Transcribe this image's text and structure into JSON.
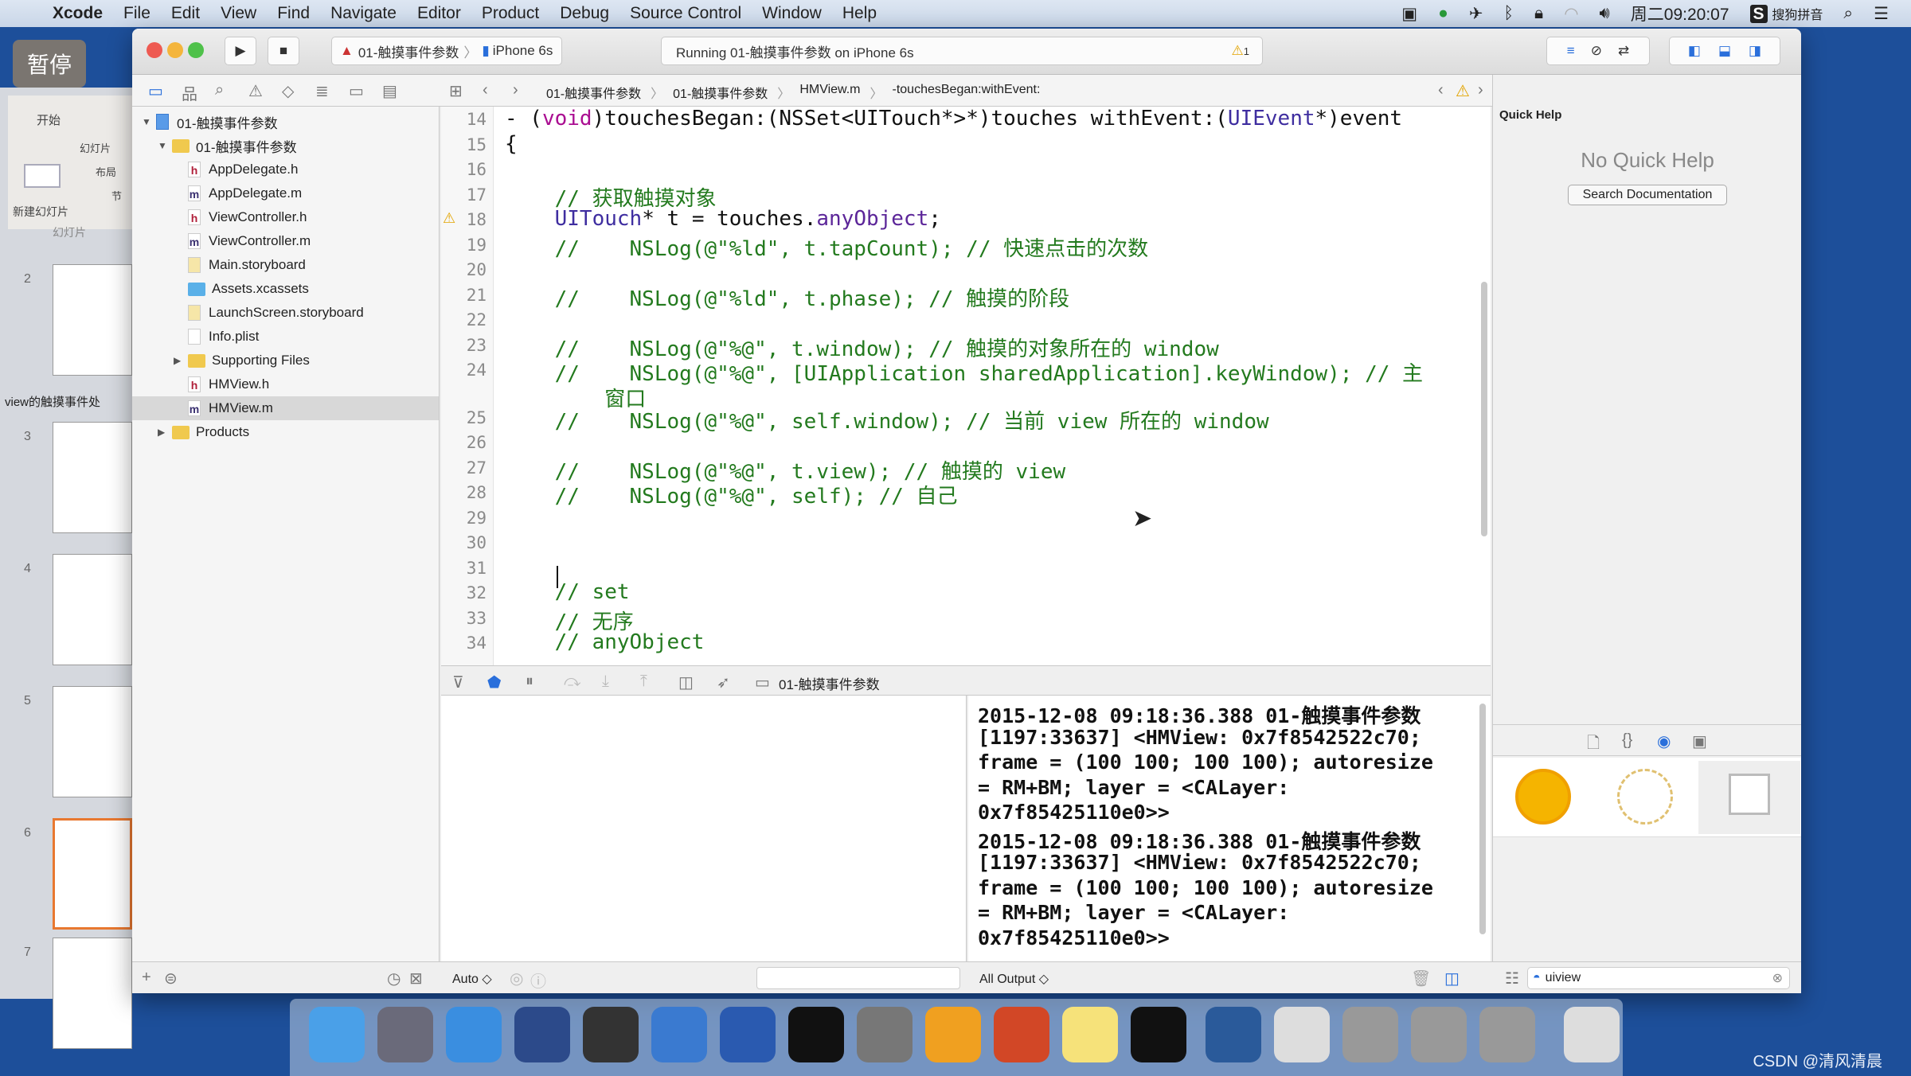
{
  "overlay": {
    "pause": "暂停"
  },
  "menubar": {
    "app": "Xcode",
    "items": [
      "File",
      "Edit",
      "View",
      "Find",
      "Navigate",
      "Editor",
      "Product",
      "Debug",
      "Source Control",
      "Window",
      "Help"
    ],
    "clock": "周二09:20:07",
    "ime": "搜狗拼音"
  },
  "ppt": {
    "tab_home": "开始",
    "group_slides": "幻灯片",
    "new_slide": "新建幻灯片",
    "layout": "布局",
    "section": "节",
    "tab_slides": "幻灯片",
    "section_label": "view的触摸事件处",
    "slide_numbers": [
      "2",
      "3",
      "4",
      "5",
      "6",
      "7"
    ]
  },
  "toolbar": {
    "scheme": "01-触摸事件参数",
    "device": "iPhone 6s",
    "status": "Running 01-触摸事件参数 on iPhone 6s",
    "warning_count": "1"
  },
  "jumpbar": {
    "crumbs": [
      "01-触摸事件参数",
      "01-触摸事件参数",
      "HMView.m",
      "-touchesBegan:withEvent:"
    ]
  },
  "navigator": {
    "items": [
      {
        "label": "01-触摸事件参数",
        "type": "project",
        "level": 0
      },
      {
        "label": "01-触摸事件参数",
        "type": "folder",
        "level": 1
      },
      {
        "label": "AppDelegate.h",
        "type": "h",
        "level": 2
      },
      {
        "label": "AppDelegate.m",
        "type": "m",
        "level": 2
      },
      {
        "label": "ViewController.h",
        "type": "h",
        "level": 2
      },
      {
        "label": "ViewController.m",
        "type": "m",
        "level": 2
      },
      {
        "label": "Main.storyboard",
        "type": "sb",
        "level": 2
      },
      {
        "label": "Assets.xcassets",
        "type": "assets",
        "level": 2
      },
      {
        "label": "LaunchScreen.storyboard",
        "type": "sb",
        "level": 2
      },
      {
        "label": "Info.plist",
        "type": "plist",
        "level": 2
      },
      {
        "label": "Supporting Files",
        "type": "folder-closed",
        "level": 2
      },
      {
        "label": "HMView.h",
        "type": "h",
        "level": 2
      },
      {
        "label": "HMView.m",
        "type": "m",
        "level": 2,
        "selected": true
      },
      {
        "label": "Products",
        "type": "folder-closed",
        "level": 1
      }
    ]
  },
  "editor": {
    "lines": [
      {
        "n": "14",
        "segs": [
          {
            "t": "- (",
            "k": "plain"
          },
          {
            "t": "void",
            "k": "kw"
          },
          {
            "t": ")touchesBegan:(NSSet<UITouch*>*)touches withEvent:(",
            "k": "plain"
          },
          {
            "t": "UIEvent",
            "k": "type"
          },
          {
            "t": "*)event",
            "k": "plain"
          }
        ]
      },
      {
        "n": "15",
        "segs": [
          {
            "t": "{",
            "k": "plain"
          }
        ]
      },
      {
        "n": "16",
        "segs": []
      },
      {
        "n": "17",
        "segs": [
          {
            "t": "    // 获取触摸对象",
            "k": "cm"
          }
        ]
      },
      {
        "n": "18",
        "warning": true,
        "segs": [
          {
            "t": "    ",
            "k": "plain"
          },
          {
            "t": "UITouch",
            "k": "type"
          },
          {
            "t": "* t = touches.",
            "k": "plain"
          },
          {
            "t": "anyObject",
            "k": "method"
          },
          {
            "t": ";",
            "k": "plain"
          }
        ]
      },
      {
        "n": "19",
        "segs": [
          {
            "t": "    //    NSLog(@\"%ld\", t.tapCount); // 快速点击的次数",
            "k": "cm"
          }
        ]
      },
      {
        "n": "20",
        "segs": []
      },
      {
        "n": "21",
        "segs": [
          {
            "t": "    //    NSLog(@\"%ld\", t.phase); // 触摸的阶段",
            "k": "cm"
          }
        ]
      },
      {
        "n": "22",
        "segs": []
      },
      {
        "n": "23",
        "segs": [
          {
            "t": "    //    NSLog(@\"%@\", t.window); // 触摸的对象所在的 window",
            "k": "cm"
          }
        ]
      },
      {
        "n": "24",
        "segs": [
          {
            "t": "    //    NSLog(@\"%@\", [UIApplication sharedApplication].keyWindow); // 主",
            "k": "cm"
          }
        ],
        "cont": "        窗口"
      },
      {
        "n": "25",
        "segs": [
          {
            "t": "    //    NSLog(@\"%@\", self.window); // 当前 view 所在的 window",
            "k": "cm"
          }
        ]
      },
      {
        "n": "26",
        "segs": []
      },
      {
        "n": "27",
        "segs": [
          {
            "t": "    //    NSLog(@\"%@\", t.view); // 触摸的 view",
            "k": "cm"
          }
        ]
      },
      {
        "n": "28",
        "segs": [
          {
            "t": "    //    NSLog(@\"%@\", self); // 自己",
            "k": "cm"
          }
        ]
      },
      {
        "n": "29",
        "segs": []
      },
      {
        "n": "30",
        "segs": []
      },
      {
        "n": "31",
        "segs": []
      },
      {
        "n": "32",
        "segs": [
          {
            "t": "    // set",
            "k": "cm"
          }
        ]
      },
      {
        "n": "33",
        "segs": [
          {
            "t": "    // 无序",
            "k": "cm"
          }
        ]
      },
      {
        "n": "34",
        "segs": [
          {
            "t": "    // anyObject",
            "k": "cm"
          }
        ]
      }
    ]
  },
  "debugbar": {
    "target": "01-触摸事件参数"
  },
  "console": {
    "lines": [
      "2015-12-08 09:18:36.388 01-触摸事件参数",
      "[1197:33637] <HMView: 0x7f8542522c70;",
      "frame = (100 100; 100 100); autoresize",
      "= RM+BM; layer = <CALayer:",
      "0x7f85425110e0>>",
      "2015-12-08 09:18:36.388 01-触摸事件参数",
      "[1197:33637] <HMView: 0x7f8542522c70;",
      "frame = (100 100; 100 100); autoresize",
      "= RM+BM; layer = <CALayer:",
      "0x7f85425110e0>>"
    ]
  },
  "bottombar": {
    "vars_mode": "Auto ◇",
    "output_mode": "All Output ◇",
    "library_filter": "uiview"
  },
  "inspector": {
    "title": "Quick Help",
    "empty": "No Quick Help",
    "search_button": "Search Documentation"
  },
  "watermark": "CSDN @清风清晨",
  "colors": {
    "desktop": "#1d4f9a",
    "comment": "#237a1e",
    "keyword": "#aa0d91",
    "type": "#3f2ea0",
    "accent": "#2a6fdb"
  }
}
